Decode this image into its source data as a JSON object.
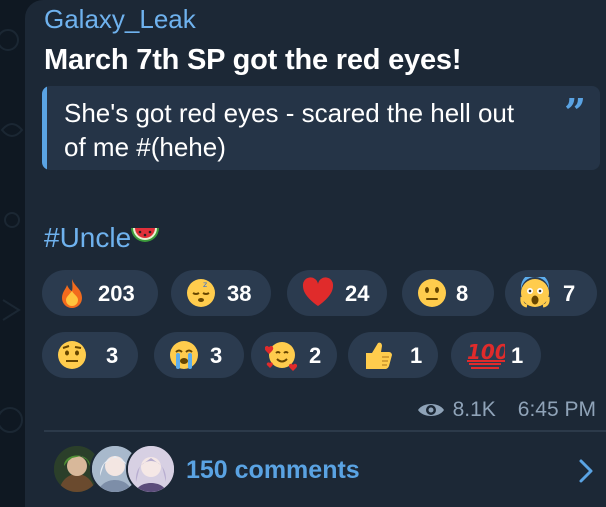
{
  "message": {
    "sender": "Galaxy_Leak",
    "headline": "March 7th SP got the red eyes!",
    "quote_text": "She's got red eyes - scared the hell out of me #(hehe)",
    "quote_icon": "quote-mark-icon",
    "hashtag": "#Uncle",
    "hashtag_emoji": "watermelon-icon"
  },
  "reactions": [
    {
      "icon": "fire-icon",
      "count": "203"
    },
    {
      "icon": "sleepy-face-icon",
      "count": "38"
    },
    {
      "icon": "red-heart-icon",
      "count": "24"
    },
    {
      "icon": "neutral-face-icon",
      "count": "8"
    },
    {
      "icon": "screaming-face-icon",
      "count": "7"
    },
    {
      "icon": "raised-eyebrow-face-icon",
      "count": "3"
    },
    {
      "icon": "crying-face-icon",
      "count": "3"
    },
    {
      "icon": "smiling-hearts-face-icon",
      "count": "2"
    },
    {
      "icon": "thumbs-up-icon",
      "count": "1"
    },
    {
      "icon": "hundred-points-icon",
      "count": "1"
    }
  ],
  "meta": {
    "views_icon": "eye-icon",
    "views": "8.1K",
    "time": "6:45 PM"
  },
  "comments": {
    "label": "150 comments",
    "chevron_icon": "chevron-right-icon"
  },
  "colors": {
    "accent": "#5aa3e3",
    "bubble": "#1c2836",
    "chip": "#2b3b4f"
  }
}
